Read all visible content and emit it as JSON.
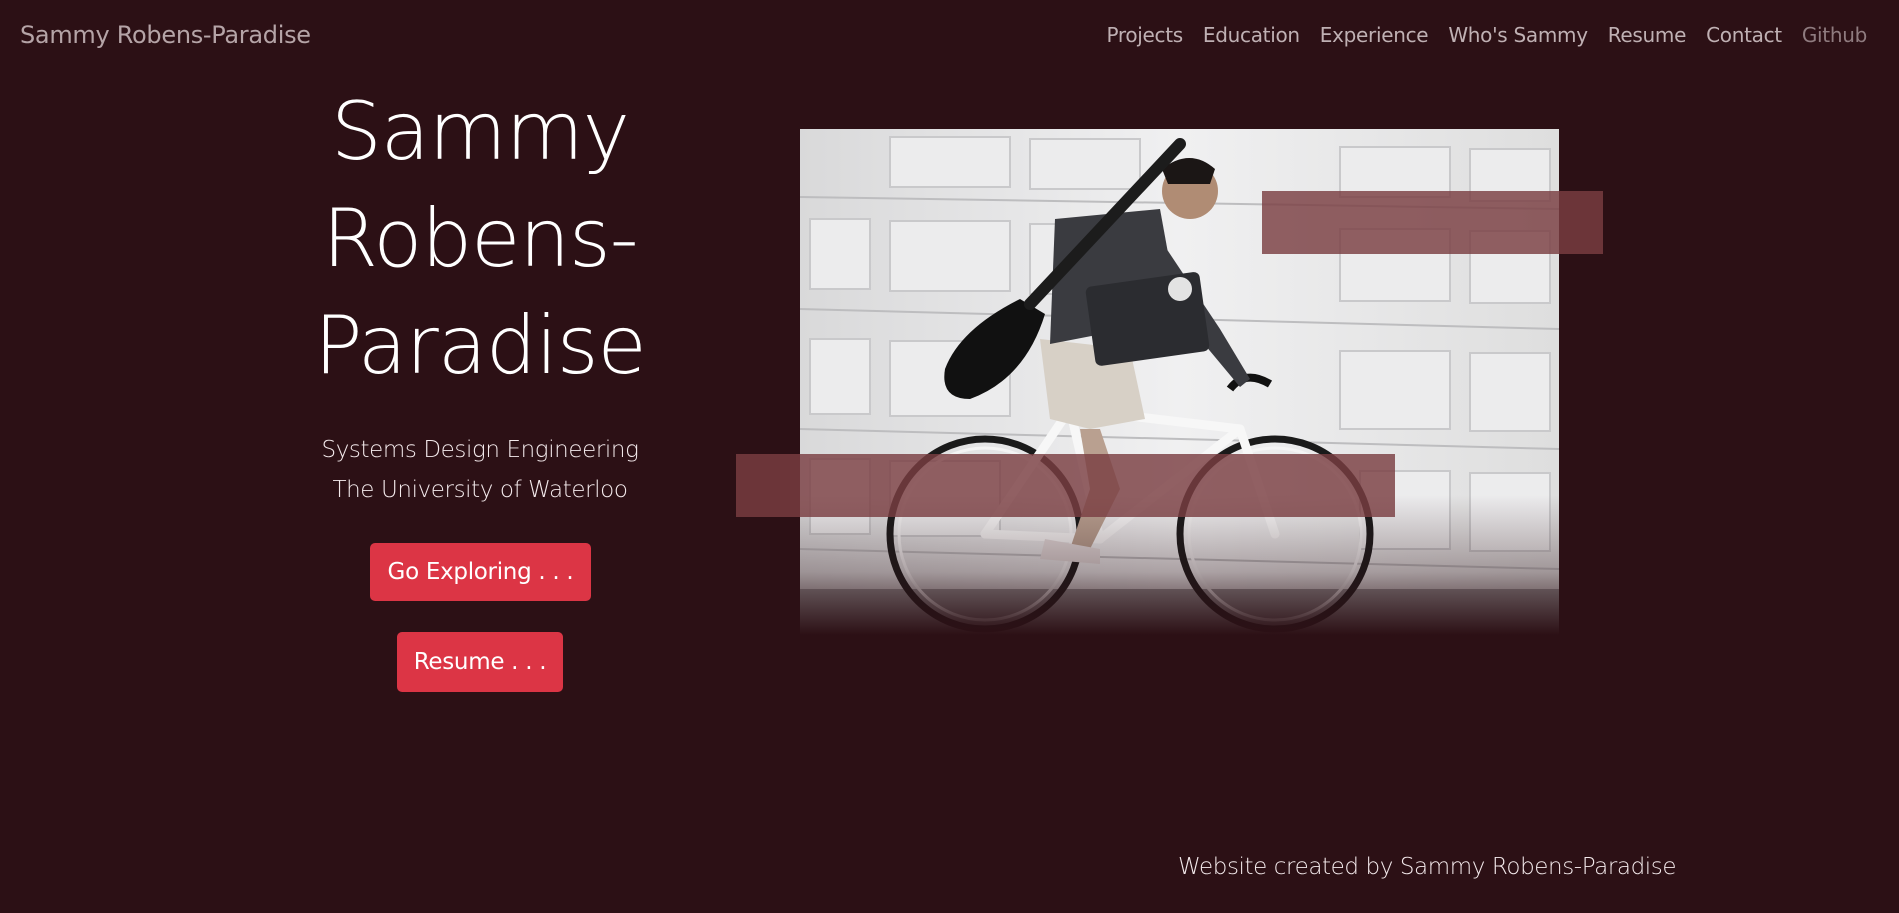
{
  "navbar": {
    "brand": "Sammy Robens-Paradise",
    "links": [
      "Projects",
      "Education",
      "Experience",
      "Who's Sammy",
      "Resume",
      "Contact",
      "Github"
    ]
  },
  "hero": {
    "title_lines": [
      "Sammy",
      "Robens-",
      "Paradise"
    ],
    "subtitle_lines": [
      "Systems Design Engineering",
      "The University of Waterloo"
    ],
    "explore_button": "Go Exploring . . .",
    "resume_button": "Resume . . ."
  },
  "photo": {
    "icon": "portrait-photo-icon"
  },
  "colors": {
    "background": "#2c1015",
    "button": "#dc3545",
    "overlay": "#7a3e42"
  },
  "footer": {
    "text": "Website created by Sammy Robens-Paradise"
  }
}
